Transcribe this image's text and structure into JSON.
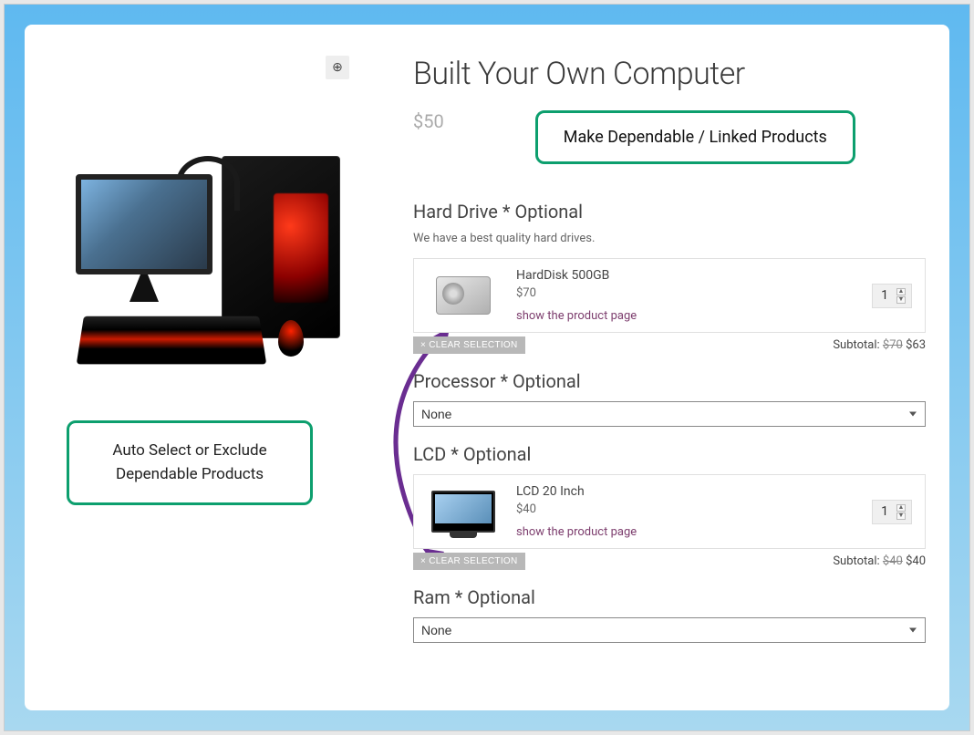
{
  "page_title": "Built Your Own Computer",
  "base_price": "$50",
  "callout_top": "Make Dependable / Linked Products",
  "callout_left_line1": "Auto Select or Exclude",
  "callout_left_line2": "Dependable Products",
  "zoom_icon_glyph": "⊕",
  "sections": {
    "hard_drive": {
      "heading": "Hard Drive * Optional",
      "description": "We have a best quality hard drives.",
      "product_name": "HardDisk 500GB",
      "product_price": "$70",
      "link_text": "show the product page",
      "qty": "1",
      "clear_label": "× CLEAR SELECTION",
      "subtotal_label": "Subtotal:",
      "subtotal_strike": "$70",
      "subtotal_final": "$63"
    },
    "processor": {
      "heading": "Processor * Optional",
      "selected": "None"
    },
    "lcd": {
      "heading": "LCD * Optional",
      "product_name": "LCD 20 Inch",
      "product_price": "$40",
      "link_text": "show the product page",
      "qty": "1",
      "clear_label": "× CLEAR SELECTION",
      "subtotal_label": "Subtotal:",
      "subtotal_strike": "$40",
      "subtotal_final": "$40"
    },
    "ram": {
      "heading": "Ram * Optional",
      "selected": "None"
    }
  }
}
